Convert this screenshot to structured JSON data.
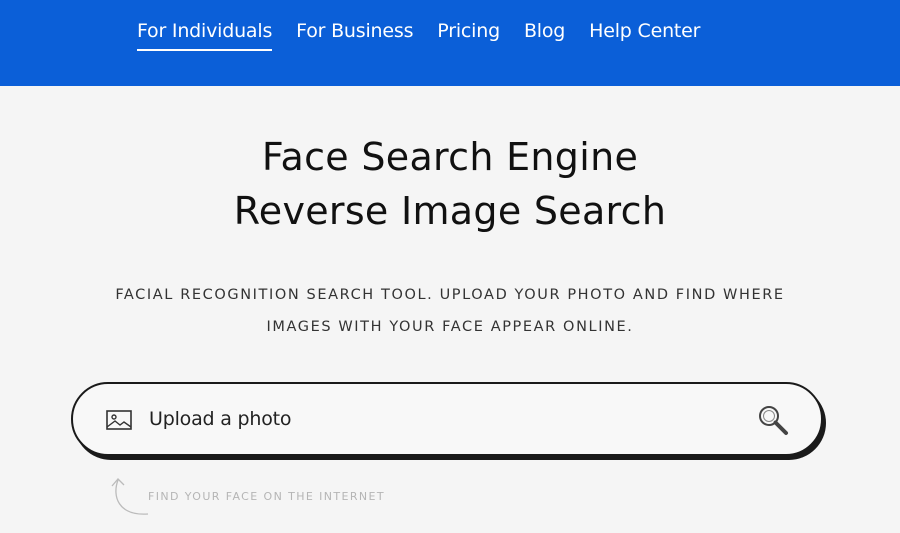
{
  "nav": {
    "links": [
      {
        "label": "For Individuals",
        "active": true
      },
      {
        "label": "For Business"
      },
      {
        "label": "Pricing"
      },
      {
        "label": "Blog"
      },
      {
        "label": "Help Center"
      }
    ]
  },
  "hero": {
    "title_line1": "Face Search Engine",
    "title_line2": "Reverse Image Search",
    "subtitle_line1": "FACIAL RECOGNITION SEARCH TOOL. UPLOAD YOUR PHOTO AND FIND WHERE",
    "subtitle_line2": "IMAGES WITH YOUR FACE APPEAR ONLINE."
  },
  "search": {
    "upload_label": "Upload a photo",
    "upload_icon": "image-icon",
    "search_icon": "search-icon"
  },
  "hint": {
    "text": "FIND YOUR FACE ON THE INTERNET",
    "icon": "curved-arrow-icon"
  },
  "colors": {
    "nav_background": "#0b5fd8",
    "page_background": "#f5f5f5",
    "text": "#111111",
    "hint_text": "#b5b5b5"
  }
}
